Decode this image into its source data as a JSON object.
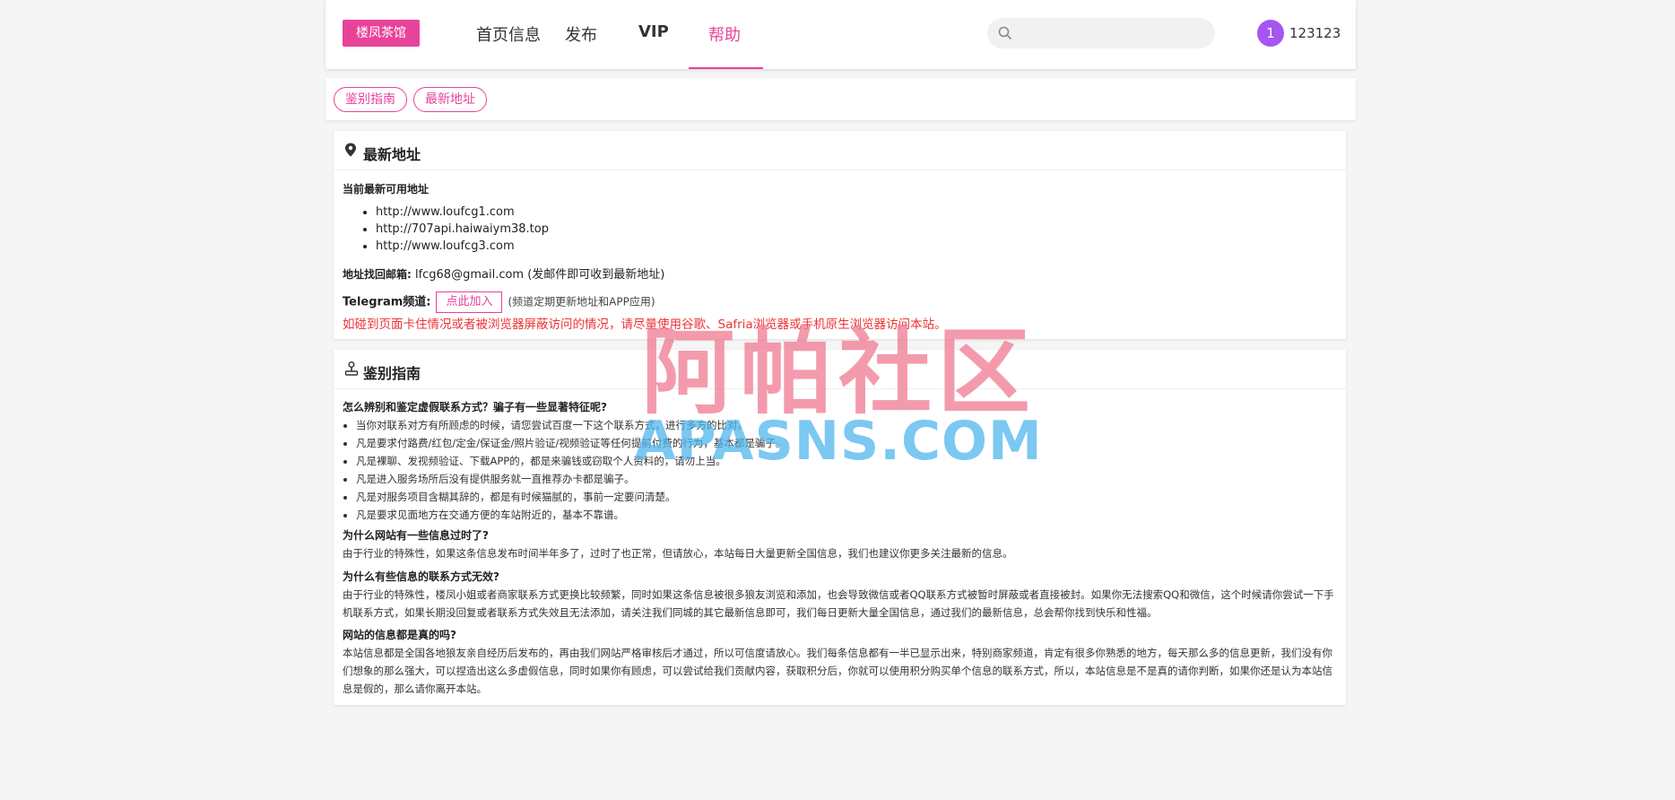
{
  "header": {
    "logo": "楼凤茶馆",
    "nav": {
      "home": "首页信息",
      "post": "发布",
      "vip": "VIP",
      "help": "帮助"
    },
    "search_placeholder": "",
    "avatar_text": "1",
    "username": "123123"
  },
  "tabs": {
    "guide": "鉴别指南",
    "address": "最新地址"
  },
  "address_card": {
    "title": "最新地址",
    "current_label": "当前最新可用地址",
    "urls": [
      "http://www.loufcg1.com",
      "http://707api.haiwaiym38.top",
      "http://www.loufcg3.com"
    ],
    "email_label": "地址找回邮箱:",
    "email": "lfcg68@gmail.com",
    "email_note": "(发邮件即可收到最新地址)",
    "telegram_label": "Telegram频道:",
    "telegram_button": "点此加入",
    "telegram_note": "(频道定期更新地址和APP应用)",
    "warning": "如碰到页面卡住情况或者被浏览器屏蔽访问的情况，请尽量使用谷歌、Safria浏览器或手机原生浏览器访问本站。"
  },
  "guide_card": {
    "title": "鉴别指南",
    "q1": "怎么辨别和鉴定虚假联系方式？骗子有一些显著特征呢?",
    "q1_items": [
      "当你对联系对方有所顾虑的时候，请您尝试百度一下这个联系方式，进行多方的比对。",
      "凡是要求付路费/红包/定金/保证金/照片验证/视频验证等任何提前付费的行为，基本都是骗子。",
      "凡是裸聊、发视频验证、下载APP的，都是来骗钱或窃取个人资料的，请勿上当。",
      "凡是进入服务场所后没有提供服务就一直推荐办卡都是骗子。",
      "凡是对服务项目含糊其辞的，都是有时候猫腻的，事前一定要问清楚。",
      "凡是要求见面地方在交通方便的车站附近的，基本不靠谱。"
    ],
    "q2": "为什么网站有一些信息过时了?",
    "a2": "由于行业的特殊性，如果这条信息发布时间半年多了，过时了也正常，但请放心，本站每日大量更新全国信息，我们也建议你更多关注最新的信息。",
    "q3": "为什么有些信息的联系方式无效?",
    "a3": "由于行业的特殊性，楼凤小姐或者商家联系方式更换比较频繁，同时如果这条信息被很多狼友浏览和添加，也会导致微信或者QQ联系方式被暂时屏蔽或者直接被封。如果你无法搜索QQ和微信，这个时候请你尝试一下手机联系方式，如果长期没回复或者联系方式失效且无法添加，请关注我们同城的其它最新信息即可，我们每日更新大量全国信息，通过我们的最新信息，总会帮你找到快乐和性福。",
    "q4": "网站的信息都是真的吗?",
    "a4": "本站信息都是全国各地狼友亲自经历后发布的，再由我们网站严格审核后才通过，所以可信度请放心。我们每条信息都有一半已显示出来，特别商家频道，肯定有很多你熟悉的地方，每天那么多的信息更新，我们没有你们想象的那么强大，可以捏造出这么多虚假信息，同时如果你有顾虑，可以尝试给我们贡献内容，获取积分后，你就可以使用积分购买单个信息的联系方式，所以，本站信息是不是真的请你判断，如果你还是认为本站信息是假的，那么请你离开本站。"
  },
  "watermark": {
    "cn": "阿帕社区",
    "en": "APASNS.COM"
  },
  "colors": {
    "accent": "#e8439a",
    "warning": "#ee3333",
    "avatar": "#a755f2"
  }
}
